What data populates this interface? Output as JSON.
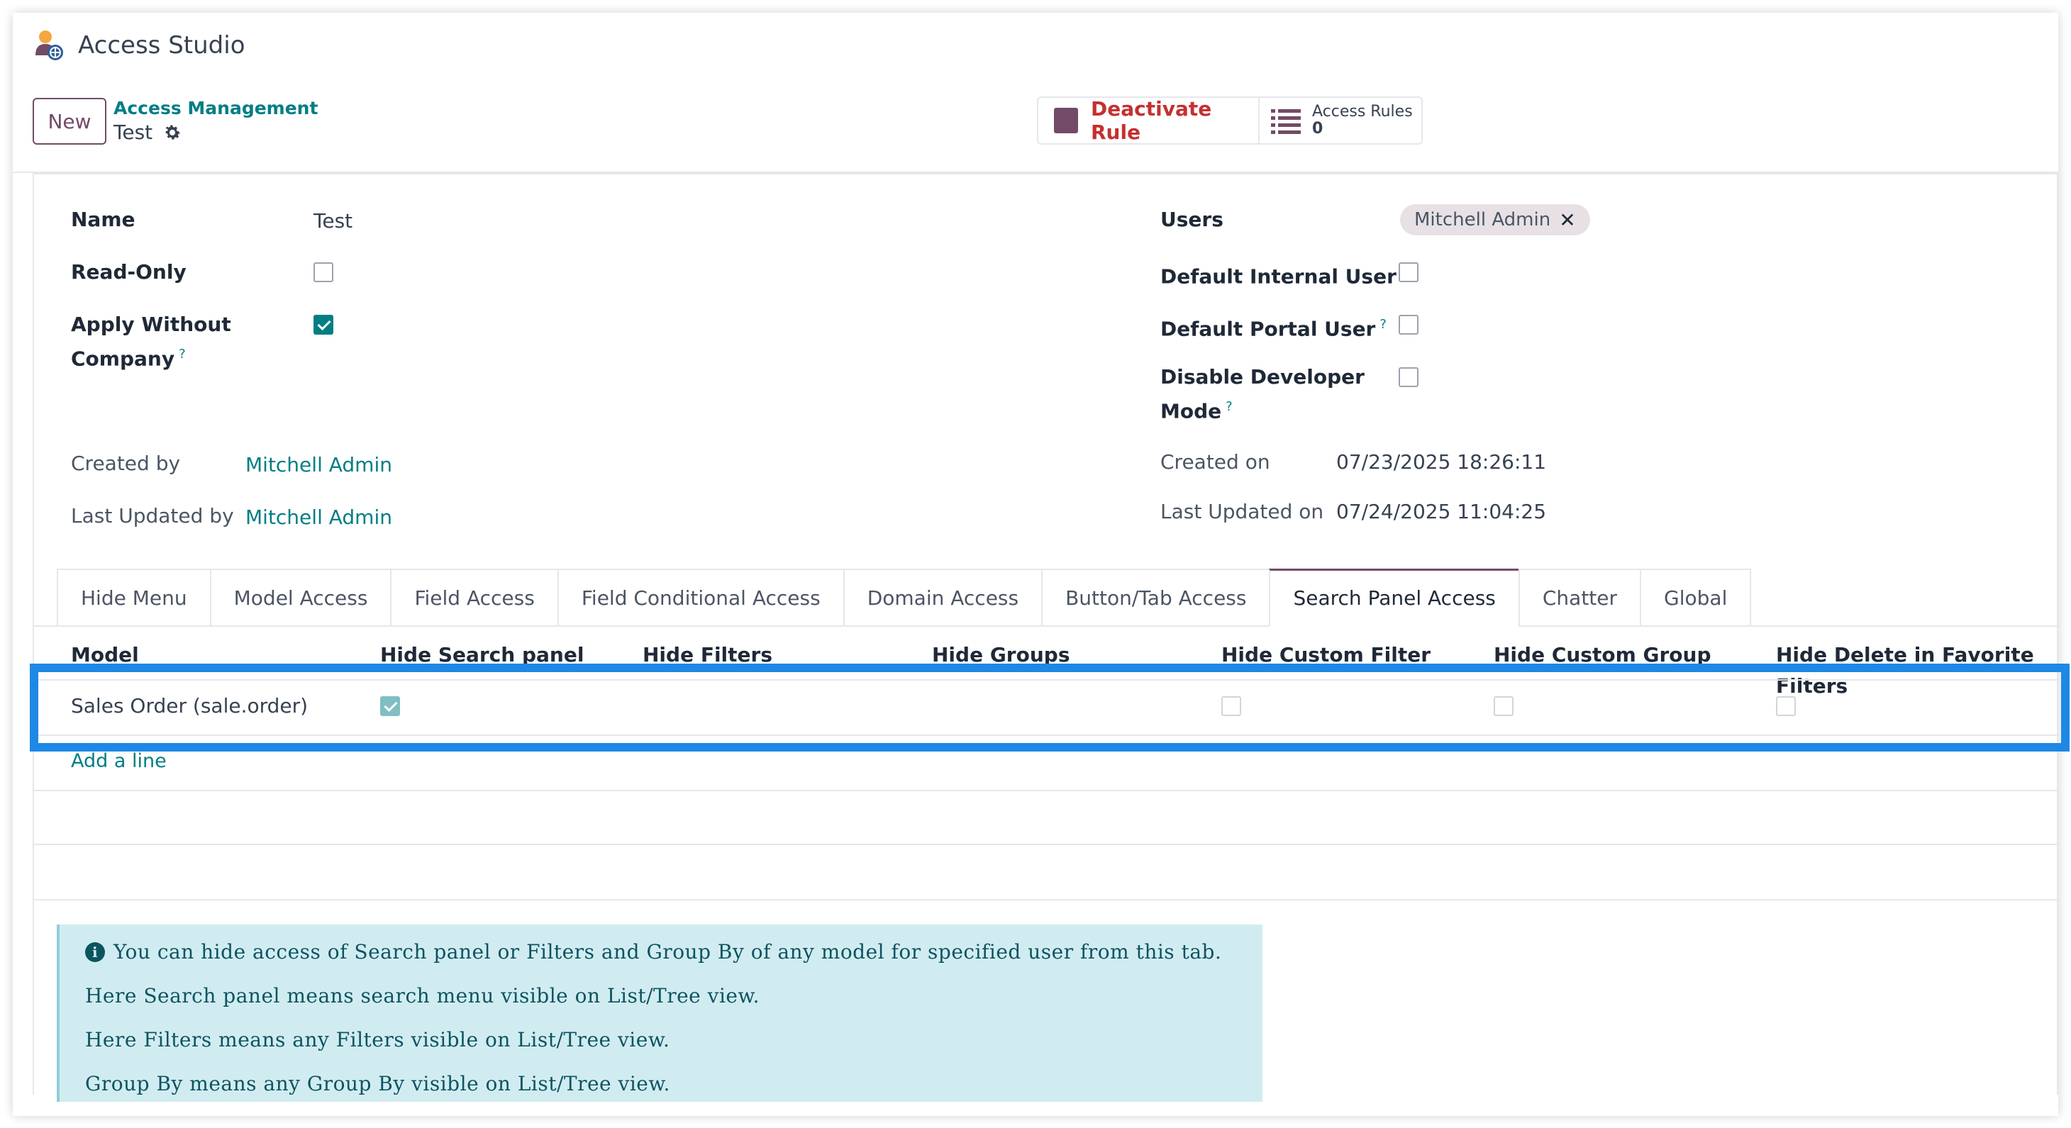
{
  "app": {
    "title": "Access Studio",
    "icon": "access-studio-app-icon"
  },
  "control_panel": {
    "new_label": "New",
    "breadcrumb_parent": "Access Management",
    "breadcrumb_current": "Test",
    "deactivate_label": "Deactivate Rule",
    "access_rules_label": "Access Rules",
    "access_rules_count": "0"
  },
  "form": {
    "name_label": "Name",
    "name_value": "Test",
    "readonly_label": "Read-Only",
    "readonly_checked": false,
    "apply_without_company_label_1": "Apply Without",
    "apply_without_company_label_2": "Company",
    "apply_without_company_checked": true,
    "help_mark": "?",
    "users_label": "Users",
    "users_tag": "Mitchell Admin",
    "users_tag_remove": "✕",
    "default_internal_label": "Default Internal User",
    "default_portal_label": "Default Portal User",
    "disable_dev_label_1": "Disable Developer",
    "disable_dev_label_2": "Mode",
    "created_by_label": "Created by",
    "created_by_value": "Mitchell Admin",
    "last_updated_by_label": "Last Updated by",
    "last_updated_by_value": "Mitchell Admin",
    "created_on_label": "Created on",
    "created_on_value": "07/23/2025 18:26:11",
    "last_updated_on_label": "Last Updated on",
    "last_updated_on_value": "07/24/2025 11:04:25"
  },
  "tabs": [
    {
      "label": "Hide Menu"
    },
    {
      "label": "Model Access"
    },
    {
      "label": "Field Access"
    },
    {
      "label": "Field Conditional Access"
    },
    {
      "label": "Domain Access"
    },
    {
      "label": "Button/Tab Access"
    },
    {
      "label": "Search Panel Access"
    },
    {
      "label": "Chatter"
    },
    {
      "label": "Global"
    }
  ],
  "active_tab": "Search Panel Access",
  "table": {
    "columns": [
      "Model",
      "Hide Search panel",
      "Hide Filters",
      "Hide Groups",
      "Hide Custom Filter",
      "Hide Custom Group",
      "Hide Delete in Favorite Filters"
    ],
    "rows": [
      {
        "model": "Sales Order (sale.order)",
        "hide_search_panel": true,
        "hide_custom_filter": false,
        "hide_custom_group": false,
        "hide_delete_favorite": false
      }
    ],
    "add_line": "Add a line"
  },
  "info": {
    "icon": "info-icon",
    "line1": "You can hide access of Search panel or Filters and Group By of any model for specified user from this tab.",
    "line2": "Here Search panel means search menu visible on List/Tree view.",
    "line3": "Here Filters means any Filters visible on List/Tree view.",
    "line4": "Group By means any Group By visible on List/Tree view."
  },
  "colors": {
    "brand": "#714b67",
    "link": "#017e84",
    "danger": "#c53030",
    "highlight": "#1e88e5",
    "info_bg": "#d1ecf1"
  }
}
